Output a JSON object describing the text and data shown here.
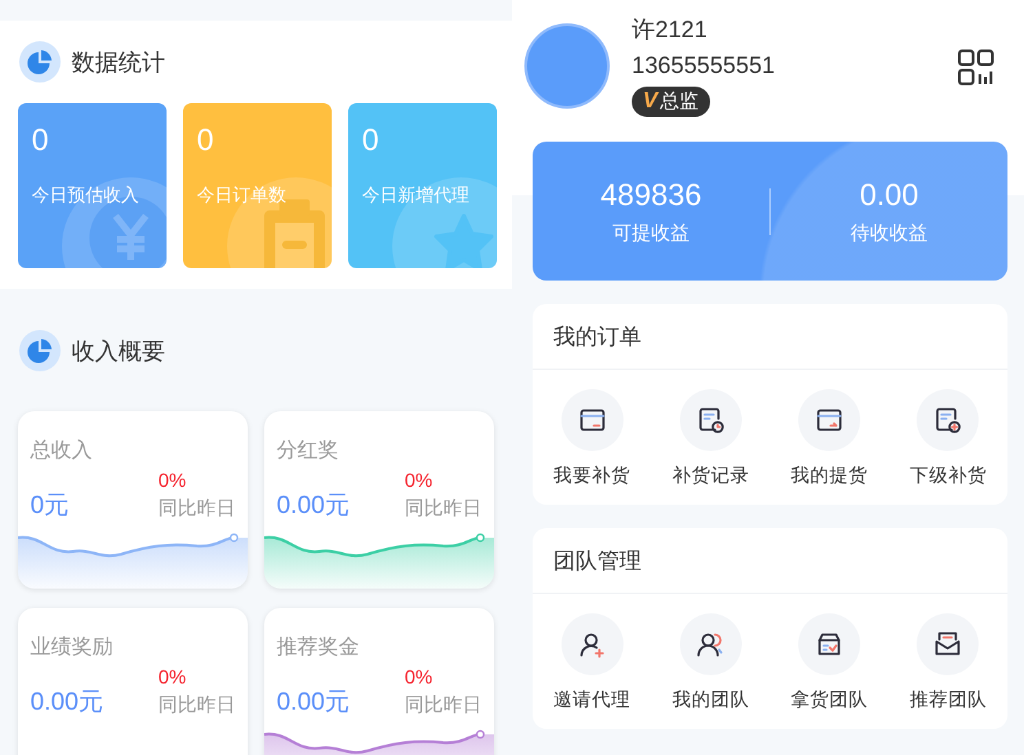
{
  "stats": {
    "title": "数据统计",
    "cards": [
      {
        "value": "0",
        "label": "今日预估收入",
        "color": "#5aa2f7"
      },
      {
        "value": "0",
        "label": "今日订单数",
        "color": "#ffbf3f"
      },
      {
        "value": "0",
        "label": "今日新增代理",
        "color": "#53c2f6"
      }
    ]
  },
  "income": {
    "title": "收入概要",
    "cards": [
      {
        "title": "总收入",
        "amount": "0元",
        "change": "0%",
        "change_label": "同比昨日",
        "color": "#8db5f7"
      },
      {
        "title": "分红奖",
        "amount": "0.00元",
        "change": "0%",
        "change_label": "同比昨日",
        "color": "#3ccfa5"
      },
      {
        "title": "业绩奖励",
        "amount": "0.00元",
        "change": "0%",
        "change_label": "同比昨日"
      },
      {
        "title": "推荐奖金",
        "amount": "0.00元",
        "change": "0%",
        "change_label": "同比昨日",
        "color": "#b57fd6"
      }
    ]
  },
  "profile": {
    "name": "许2121",
    "phone": "13655555551",
    "badge_mark": "V",
    "badge": "总监"
  },
  "earnings": [
    {
      "value": "489836",
      "label": "可提收益"
    },
    {
      "value": "0.00",
      "label": "待收收益"
    }
  ],
  "panels": [
    {
      "title": "我的订单",
      "items": [
        {
          "label": "我要补货"
        },
        {
          "label": "补货记录"
        },
        {
          "label": "我的提货"
        },
        {
          "label": "下级补货"
        }
      ]
    },
    {
      "title": "团队管理",
      "items": [
        {
          "label": "邀请代理"
        },
        {
          "label": "我的团队"
        },
        {
          "label": "拿货团队"
        },
        {
          "label": "推荐团队"
        }
      ]
    }
  ]
}
